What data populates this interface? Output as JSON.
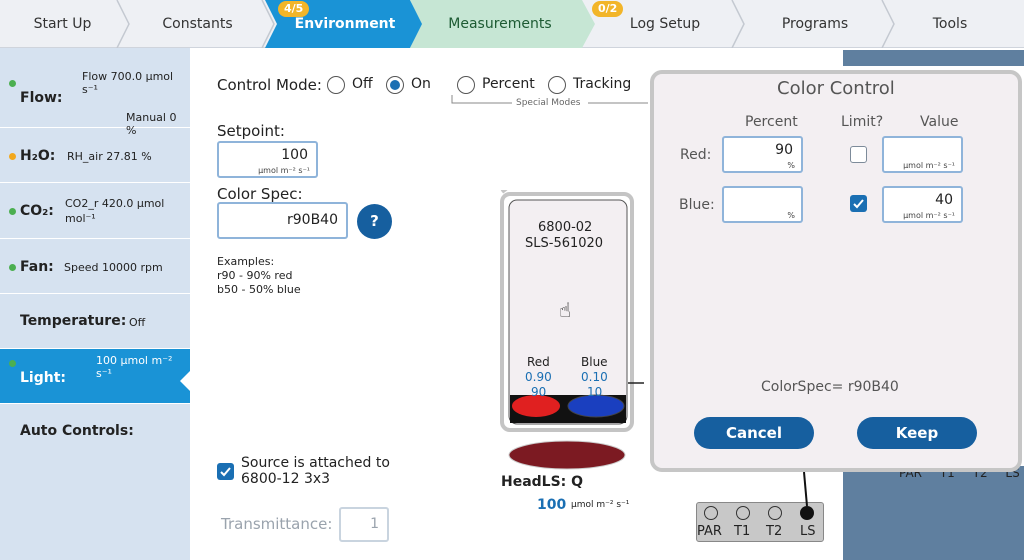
{
  "tabs": [
    {
      "label": "Start Up"
    },
    {
      "label": "Constants"
    },
    {
      "label": "Environment",
      "badge": "4/5"
    },
    {
      "label": "Measurements"
    },
    {
      "label": "Log Setup",
      "badge": "0/2"
    },
    {
      "label": "Programs"
    },
    {
      "label": "Tools"
    }
  ],
  "sidebar": {
    "flow": {
      "label": "Flow:",
      "value": "Flow 700.0 µmol s⁻¹",
      "sub": "Manual 0 %"
    },
    "h2o": {
      "label": "H₂O:",
      "value": "RH_air 27.81 %"
    },
    "co2": {
      "label": "CO₂:",
      "value_line1": "CO2_r 420.0 µmol",
      "value_line2": "mol⁻¹"
    },
    "fan": {
      "label": "Fan:",
      "value": "Speed 10000 rpm"
    },
    "temperature": {
      "label": "Temperature:",
      "value": "Off"
    },
    "light": {
      "label": "Light:",
      "value": "100 µmol m⁻² s⁻¹"
    },
    "auto": {
      "label": "Auto Controls:"
    }
  },
  "main": {
    "control_mode_label": "Control Mode:",
    "mode_off": "Off",
    "mode_on": "On",
    "mode_percent": "Percent",
    "mode_tracking": "Tracking",
    "special_modes": "Special Modes",
    "setpoint_label": "Setpoint:",
    "setpoint_value": "100",
    "setpoint_unit": "µmol m⁻² s⁻¹",
    "colorspec_label": "Color Spec:",
    "colorspec_value": "r90B40",
    "help_label": "?",
    "examples_title": "Examples:",
    "example1": "r90 - 90% red",
    "example2": "b50 - 50% blue",
    "source_line1": "Source is attached to",
    "source_line2": "6800-12 3x3",
    "transmittance_label": "Transmittance:",
    "transmittance_value": "1"
  },
  "device": {
    "model": "6800-02",
    "serial": "SLS-561020",
    "red_label": "Red",
    "red_frac": "0.90",
    "red_pct": "90",
    "blue_label": "Blue",
    "blue_frac": "0.10",
    "blue_pct": "10",
    "head_label": "HeadLS: Q",
    "head_value": "100",
    "head_unit": "µmol m⁻² s⁻¹",
    "conn_par": "PAR",
    "conn_t1": "T1",
    "conn_t2": "T2",
    "conn_ls": "LS",
    "bg_labels": "PAR T1 T2 LS"
  },
  "dialog": {
    "title": "Color Control",
    "col_percent": "Percent",
    "col_limit": "Limit?",
    "col_value": "Value",
    "red_label": "Red:",
    "red_percent": "90",
    "red_percent_unit": "%",
    "red_value": "",
    "red_value_unit": "µmol m⁻² s⁻¹",
    "red_limit": false,
    "blue_label": "Blue:",
    "blue_percent": "",
    "blue_percent_unit": "%",
    "blue_value": "40",
    "blue_value_unit": "µmol m⁻² s⁻¹",
    "blue_limit": true,
    "colorspec_line": "ColorSpec= r90B40",
    "cancel": "Cancel",
    "keep": "Keep"
  },
  "colors": {
    "accent": "#1a93d6",
    "dark_blue": "#165f9f",
    "visited_tab": "#c6e6d4",
    "badge": "#f2b529",
    "status_green": "#4caf50",
    "status_orange": "#f2a81d",
    "red_led": "#e02020",
    "blue_led": "#1a3fbf"
  }
}
